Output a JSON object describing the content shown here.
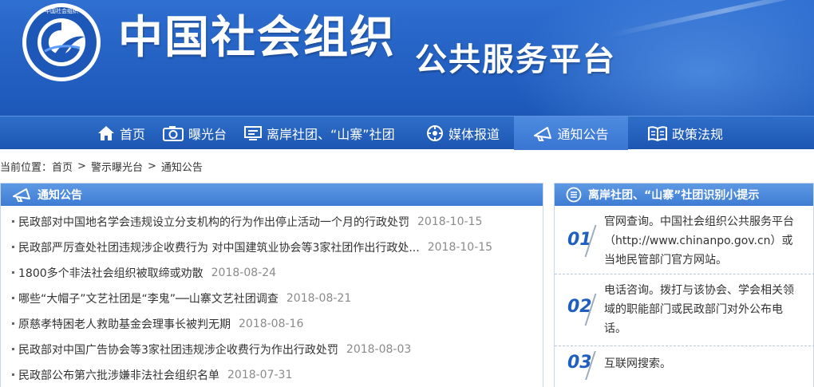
{
  "header": {
    "title": "中国社会组织",
    "subtitle": "公共服务平台",
    "logo_text": "中国社会组织 CHINA SOCIAL ORGANIZATION",
    "brand_color": "#2563c5"
  },
  "nav": {
    "items": [
      {
        "label": "首页",
        "icon": "home-icon"
      },
      {
        "label": "曝光台",
        "icon": "camera-icon"
      },
      {
        "label": "离岸社团、“山寨”社团",
        "icon": "monitor-icon"
      },
      {
        "label": "媒体报道",
        "icon": "media-icon"
      },
      {
        "label": "通知公告",
        "icon": "megaphone-icon",
        "active": true
      },
      {
        "label": "政策法规",
        "icon": "book-icon"
      }
    ]
  },
  "breadcrumb": {
    "prefix": "当前位置：",
    "items": [
      "首页",
      "警示曝光台",
      "通知公告"
    ],
    "separator": ">"
  },
  "notices": {
    "heading": "通知公告",
    "items": [
      {
        "title": "民政部对中国地名学会违规设立分支机构的行为作出停止活动一个月的行政处罚",
        "date": "2018-10-15"
      },
      {
        "title": "民政部严厉查处社团违规涉企收费行为 对中国建筑业协会等3家社团作出行政处...",
        "date": "2018-10-15"
      },
      {
        "title": "1800多个非法社会组织被取缔或劝散",
        "date": "2018-08-24"
      },
      {
        "title": "哪些“大帽子”文艺社团是“李鬼”──山寨文艺社团调查",
        "date": "2018-08-21"
      },
      {
        "title": "原慈孝特困老人救助基金会理事长被判无期",
        "date": "2018-08-16"
      },
      {
        "title": "民政部对中国广告协会等3家社团违规涉企收费行为作出行政处罚",
        "date": "2018-08-03"
      },
      {
        "title": "民政部公布第六批涉嫌非法社会组织名单",
        "date": "2018-07-31"
      }
    ]
  },
  "tips": {
    "heading": "离岸社团、“山寨”社团识别小提示",
    "items": [
      {
        "num": "01",
        "text": "官网查询。中国社会组织公共服务平台（http://www.chinanpo.gov.cn）或当地民管部门官方网站。"
      },
      {
        "num": "02",
        "text": "电话咨询。拨打与该协会、学会相关领域的职能部门或民政部门对外公布电话。"
      },
      {
        "num": "03",
        "text": "互联网搜索。"
      }
    ]
  }
}
